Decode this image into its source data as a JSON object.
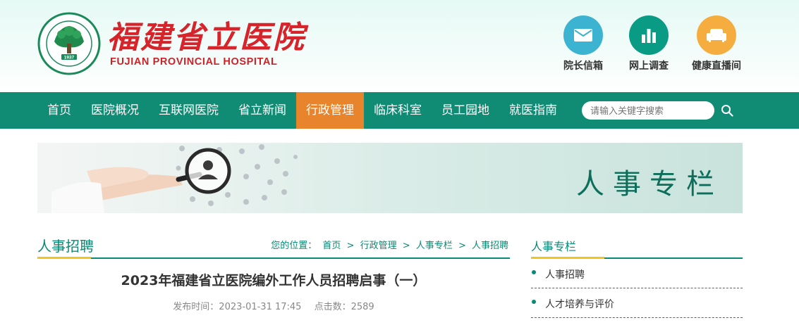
{
  "header": {
    "logo_cn": "福建省立医院",
    "logo_en": "FUJIAN PROVINCIAL HOSPITAL",
    "seal_year": "1937",
    "seal_text_cn": "福建省立医院",
    "seal_text_en": "Fujian Provincial Hospital",
    "quick_links": [
      {
        "label": "院长信箱",
        "icon": "mail-icon",
        "color": "#3cb3d1"
      },
      {
        "label": "网上调查",
        "icon": "bar-chart-icon",
        "color": "#0a9b84"
      },
      {
        "label": "健康直播间",
        "icon": "sofa-icon",
        "color": "#f6ad3f"
      }
    ]
  },
  "nav": {
    "items": [
      {
        "label": "首页"
      },
      {
        "label": "医院概况"
      },
      {
        "label": "互联网医院"
      },
      {
        "label": "省立新闻"
      },
      {
        "label": "行政管理",
        "active": true
      },
      {
        "label": "临床科室"
      },
      {
        "label": "员工园地"
      },
      {
        "label": "就医指南"
      }
    ],
    "search_placeholder": "请输入关键字搜索",
    "search_icon": "search-icon",
    "bg_color": "#108c74",
    "active_color": "#e8842b"
  },
  "banner": {
    "title": "人事专栏"
  },
  "main": {
    "section_title": "人事招聘",
    "breadcrumb": {
      "prefix": "您的位置：",
      "items": [
        "首页",
        "行政管理",
        "人事专栏",
        "人事招聘"
      ],
      "separator": ">"
    },
    "article": {
      "title": "2023年福建省立医院编外工作人员招聘启事（一）",
      "publish_time": "发布时间：2023-01-31 17:45",
      "clicks": "点击数：2589"
    }
  },
  "sidebar": {
    "title": "人事专栏",
    "items": [
      {
        "label": "人事招聘"
      },
      {
        "label": "人才培养与评价"
      }
    ]
  }
}
